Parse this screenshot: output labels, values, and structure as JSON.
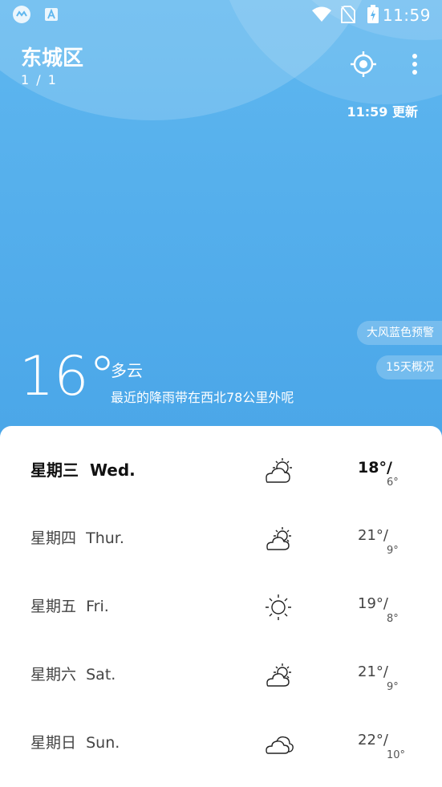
{
  "status_bar": {
    "time": "11:59",
    "icons": [
      "app-circle-icon",
      "font-a-icon",
      "wifi-icon",
      "no-sim-icon",
      "battery-charging-icon"
    ]
  },
  "header": {
    "location": "东城区",
    "page_indicator": "1 / 1",
    "update_time": "11:59 更新",
    "actions": [
      "locate-icon",
      "more-vert-icon"
    ]
  },
  "pills": {
    "alert": "大风蓝色预警",
    "forecast_15d": "15天概况"
  },
  "current": {
    "temperature": "16°",
    "condition": "多云",
    "notice": "最近的降雨带在西北78公里外呢"
  },
  "forecast": [
    {
      "day_cn": "星期三",
      "day_en": "Wed.",
      "high": "18°",
      "low": "6°",
      "icon": "partly-cloudy-icon"
    },
    {
      "day_cn": "星期四",
      "day_en": "Thur.",
      "high": "21°",
      "low": "9°",
      "icon": "partly-cloudy-icon"
    },
    {
      "day_cn": "星期五",
      "day_en": "Fri.",
      "high": "19°",
      "low": "8°",
      "icon": "sunny-icon"
    },
    {
      "day_cn": "星期六",
      "day_en": "Sat.",
      "high": "21°",
      "low": "9°",
      "icon": "partly-cloudy-icon"
    },
    {
      "day_cn": "星期日",
      "day_en": "Sun.",
      "high": "22°",
      "low": "10°",
      "icon": "cloudy-icon"
    }
  ],
  "colors": {
    "sky": "#55afec",
    "card": "#ffffff",
    "text_dark": "#111111"
  }
}
